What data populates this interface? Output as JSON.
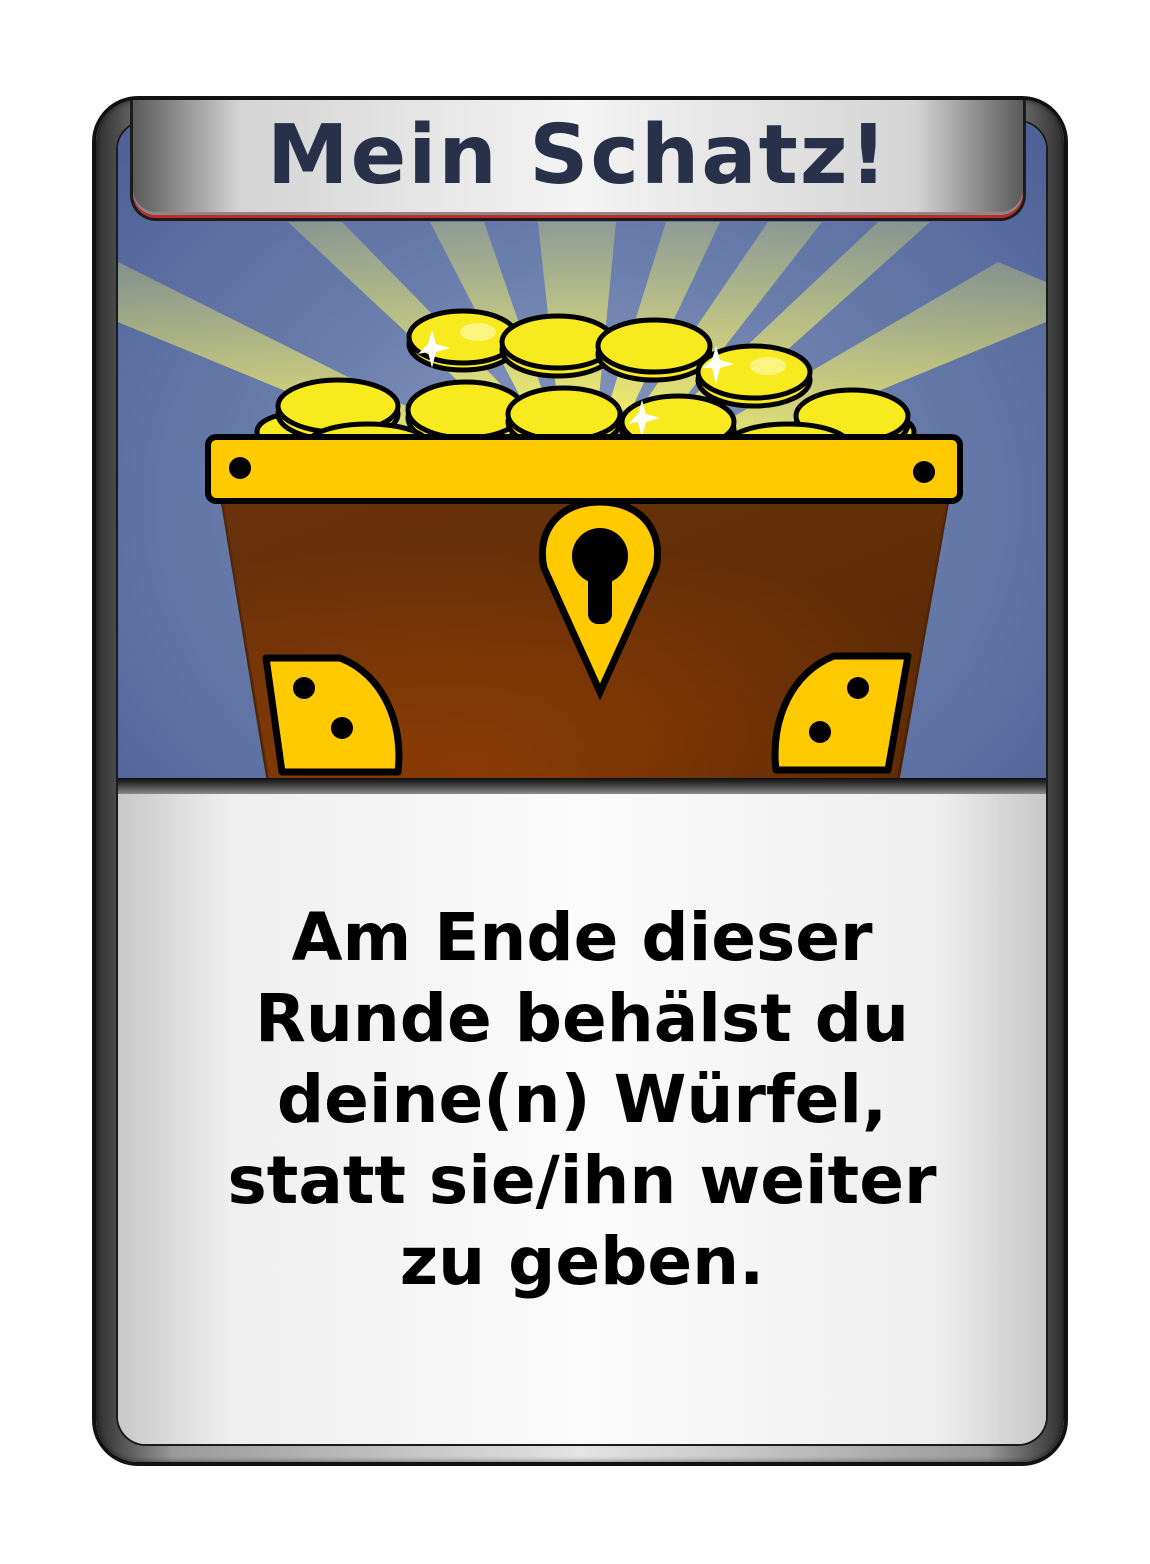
{
  "card": {
    "title": "Mein Schatz!",
    "text": "Am Ende dieser\nRunde behälst du\ndeine(n) Würfel,\nstatt sie/ihn weiter\nzu geben.",
    "illustration": "treasure-chest-icon"
  },
  "colors": {
    "title_text": "#28304a",
    "art_background": "#4c6096",
    "chest_brown": "#8a3c08",
    "gold": "#ffd400",
    "coin": "#f7ea1e",
    "banner_trim": "#c22a2a"
  }
}
